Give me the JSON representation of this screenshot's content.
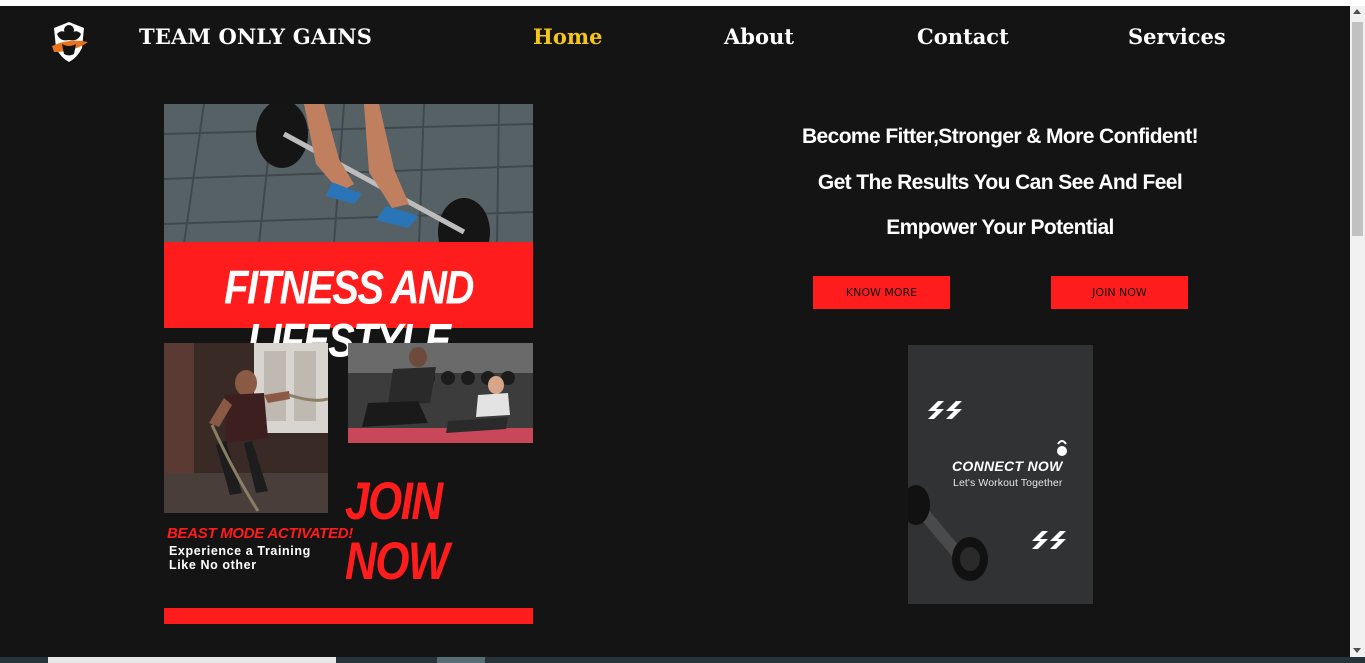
{
  "brand": {
    "name": "TEAM ONLY GAINS",
    "logo_icon": "muscle-shield-logo-icon"
  },
  "nav": {
    "items": [
      {
        "label": "Home",
        "active": true
      },
      {
        "label": "About",
        "active": false
      },
      {
        "label": "Contact",
        "active": false
      },
      {
        "label": "Services",
        "active": false
      }
    ],
    "active_color": "#f5c518"
  },
  "poster": {
    "banner": "FITNESS AND LIFESTYLE",
    "join": "JOIN NOW",
    "beast": "BEAST MODE ACTIVATED!",
    "line1": "Experience a Training",
    "line2": "Like No other",
    "accent_color": "#ff1c1c"
  },
  "taglines": [
    "Become Fitter,Stronger & More Confident!",
    "Get The Results You Can See And Feel",
    "Empower Your Potential"
  ],
  "buttons": {
    "know_more": "KNOW MORE",
    "join_now": "JOIN NOW"
  },
  "connect_card": {
    "title": "CONNECT NOW",
    "subtitle": "Let's Workout Together",
    "icons": [
      "double-chevron-icon",
      "kettlebell-icon",
      "dumbbell-icon"
    ]
  }
}
